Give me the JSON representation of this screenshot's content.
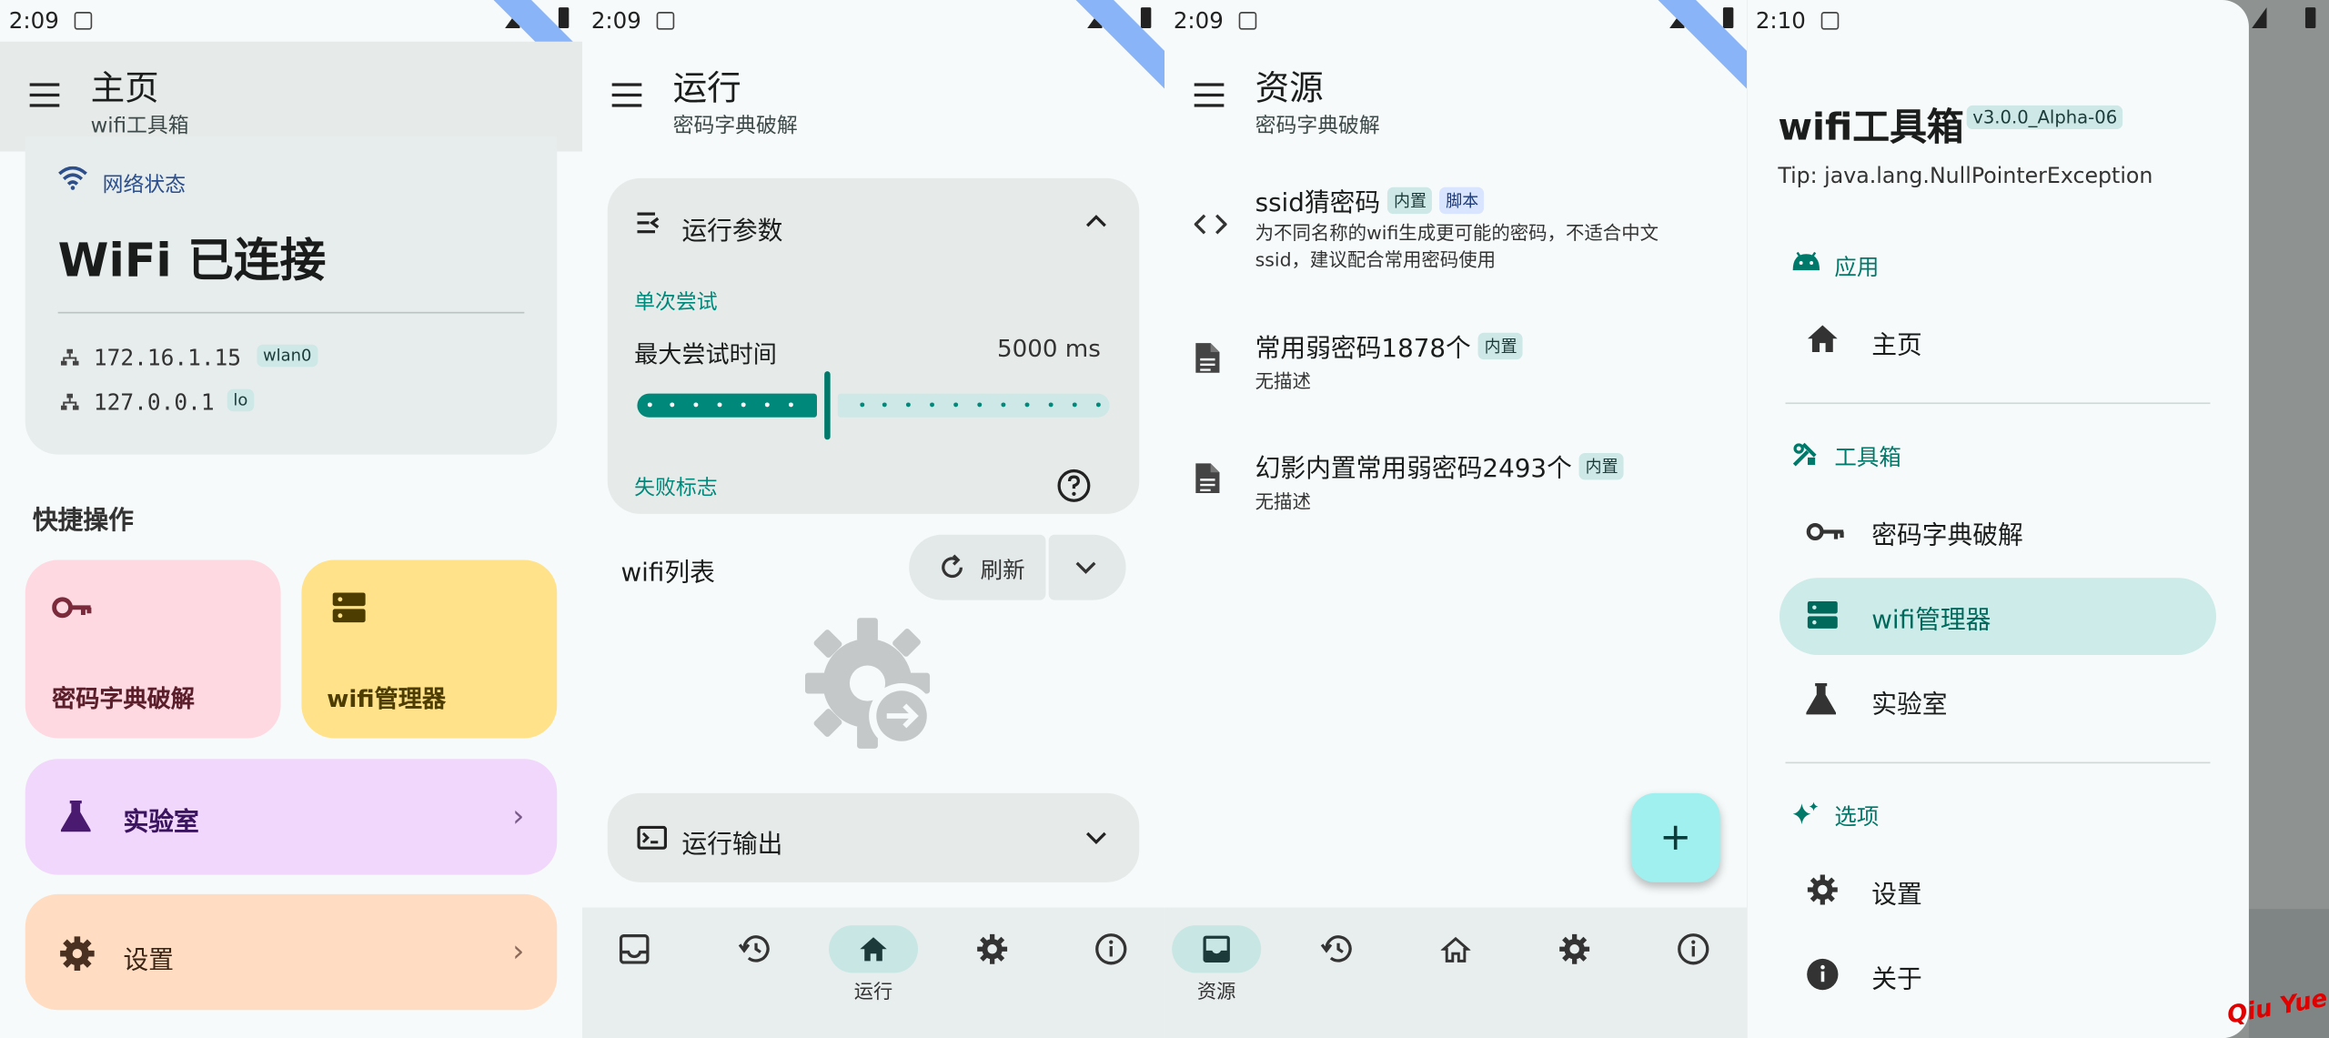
{
  "colors": {
    "accent": "#00897b",
    "card_pink": "#ffd9e1",
    "card_yellow": "#ffe28a",
    "card_purple": "#f1d7fb",
    "card_orange": "#ffdcc2",
    "selected_bg": "#cdebe9"
  },
  "status": {
    "p1_time": "2:09",
    "p2_time": "2:09",
    "p3_time": "2:09",
    "p4_time": "2:10"
  },
  "panel1": {
    "title": "主页",
    "subtitle": "wifi工具箱",
    "network": {
      "heading": "网络状态",
      "status": "WiFi 已连接",
      "addresses": [
        {
          "ip": "172.16.1.15",
          "iface": "wlan0"
        },
        {
          "ip": "127.0.0.1",
          "iface": "lo"
        }
      ]
    },
    "quick_heading": "快捷操作",
    "quick": {
      "crack_label": "密码字典破解",
      "wifi_label": "wifi管理器",
      "lab_label": "实验室",
      "settings_label": "设置"
    }
  },
  "panel2": {
    "title": "运行",
    "subtitle": "密码字典破解",
    "params": {
      "heading": "运行参数",
      "single_try": "单次尝试",
      "max_time_label": "最大尝试时间",
      "max_time_value": "5000 ms",
      "slider_fraction": 0.4,
      "fail_flag": "失败标志"
    },
    "wifi_list_label": "wifi列表",
    "refresh_label": "刷新",
    "output_heading": "运行输出",
    "nav": {
      "active_label": "运行"
    }
  },
  "panel3": {
    "title": "资源",
    "subtitle": "密码字典破解",
    "resources": [
      {
        "title": "ssid猜密码",
        "tags": [
          "内置",
          "脚本"
        ],
        "desc": "为不同名称的wifi生成更可能的密码，不适合中文ssid，建议配合常用密码使用",
        "icon": "code-icon"
      },
      {
        "title": "常用弱密码1878个",
        "tags": [
          "内置"
        ],
        "desc": "无描述",
        "icon": "document-icon"
      },
      {
        "title": "幻影内置常用弱密码2493个",
        "tags": [
          "内置"
        ],
        "desc": "无描述",
        "icon": "document-icon"
      }
    ],
    "fab_icon": "plus-icon",
    "nav": {
      "active_label": "资源"
    }
  },
  "panel4": {
    "app_title": "wifi工具箱",
    "version": "v3.0.0_Alpha-06",
    "tip": "Tip: java.lang.NullPointerException",
    "section_app": "应用",
    "item_home": "主页",
    "section_tools": "工具箱",
    "item_crack": "密码字典破解",
    "item_wifi": "wifi管理器",
    "item_lab": "实验室",
    "section_options": "选项",
    "item_settings": "设置",
    "item_about": "关于",
    "watermark": "Qiu Yue"
  }
}
